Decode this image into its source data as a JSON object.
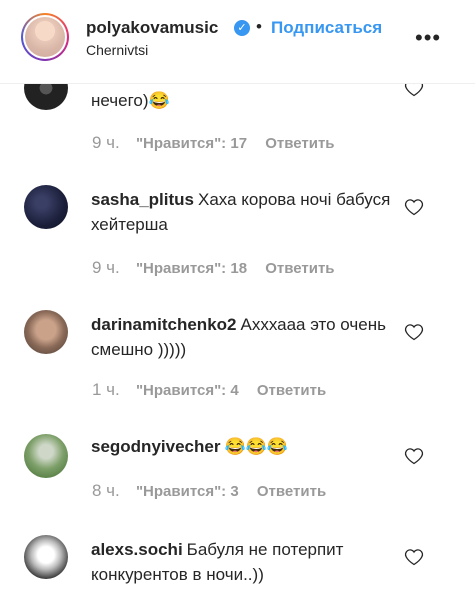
{
  "header": {
    "username": "polyakovamusic",
    "dot": "•",
    "follow_label": "Подписаться",
    "location": "Chernivtsi",
    "more_icon": "more-horizontal-icon",
    "more_glyph": "•••"
  },
  "comments": [
    {
      "user": "",
      "text": "нечего)😂",
      "time": "9 ч.",
      "likes": "\"Нравится\": 17",
      "reply": "Ответить"
    },
    {
      "user": "sasha_plitus",
      "text": "Хаха корова ночі бабуся хейтерша",
      "time": "9 ч.",
      "likes": "\"Нравится\": 18",
      "reply": "Ответить"
    },
    {
      "user": "darinamitchenko2",
      "text": "Ахххааа это очень смешно )))))",
      "time": "1 ч.",
      "likes": "\"Нравится\": 4",
      "reply": "Ответить"
    },
    {
      "user": "segodnyivecher",
      "text": "😂😂😂",
      "time": "8 ч.",
      "likes": "\"Нравится\": 3",
      "reply": "Ответить"
    },
    {
      "user": "alexs.sochi",
      "text": "Бабуля не потерпит конкурентов в ночи..))",
      "time": "",
      "likes": "",
      "reply": ""
    }
  ],
  "colors": {
    "accent": "#3897f0",
    "muted": "#999999",
    "text": "#262626"
  }
}
